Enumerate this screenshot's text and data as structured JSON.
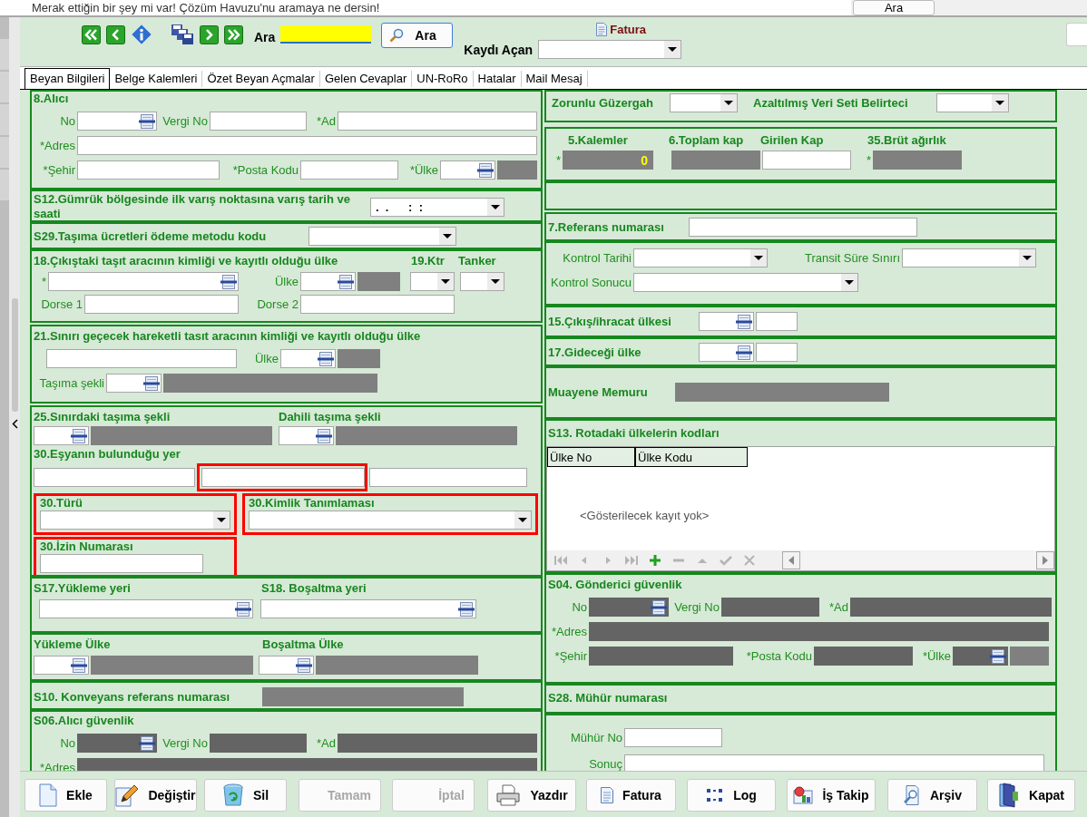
{
  "top_bar": {
    "message": "Merak ettiğin bir şey mi var! Çözüm Havuzu'nu aramaya ne dersin!",
    "button": "Ara"
  },
  "toolbar": {
    "search_label": "Ara",
    "search_button": "Ara",
    "invoice_link": "Fatura",
    "opener_label": "Kaydı Açan"
  },
  "tabs": [
    {
      "label": "Beyan Bilgileri",
      "selected": true
    },
    {
      "label": "Belge Kalemleri",
      "selected": false
    },
    {
      "label": "Özet Beyan Açmalar",
      "selected": false
    },
    {
      "label": "Gelen Cevaplar",
      "selected": false
    },
    {
      "label": "UN-RoRo",
      "selected": false
    },
    {
      "label": "Hatalar",
      "selected": false
    },
    {
      "label": "Mail Mesaj",
      "selected": false
    }
  ],
  "left_sections": [
    {
      "kind": "form",
      "rows": [
        [
          {
            "kind": "heading",
            "text": "8.Alıcı"
          }
        ],
        [
          {
            "kind": "label",
            "text": "No"
          },
          {
            "kind": "lookup",
            "disabled": false
          },
          {
            "kind": "label",
            "text": "Vergi No"
          },
          {
            "kind": "input",
            "disabled": false
          },
          {
            "kind": "label",
            "text": "*Ad"
          },
          {
            "kind": "input",
            "disabled": false
          }
        ],
        [
          {
            "kind": "label",
            "text": "*Adres"
          },
          {
            "kind": "input",
            "disabled": false
          }
        ],
        [
          {
            "kind": "label",
            "text": "*Şehir"
          },
          {
            "kind": "input",
            "disabled": false
          },
          {
            "kind": "label",
            "text": "*Posta Kodu"
          },
          {
            "kind": "input",
            "disabled": false
          },
          {
            "kind": "label",
            "text": "*Ülke"
          },
          {
            "kind": "lookup",
            "disabled": false
          },
          {
            "kind": "display"
          }
        ]
      ]
    },
    {
      "kind": "form",
      "rows": [
        [
          {
            "kind": "heading",
            "text": "S12.Gümrük bölgesinde ilk varış noktasına varış tarih ve saati"
          },
          {
            "kind": "combo",
            "value": ".  .      :  :"
          }
        ]
      ]
    },
    {
      "kind": "form",
      "rows": [
        [
          {
            "kind": "heading",
            "text": "S29.Taşıma ücretleri ödeme metodu kodu"
          },
          {
            "kind": "combo"
          }
        ]
      ]
    },
    {
      "kind": "form",
      "rows": [
        [
          {
            "kind": "heading",
            "text": "18.Çıkıştaki taşıt aracının kimliği ve kayıtlı olduğu ülke"
          },
          {
            "kind": "heading",
            "text": "19.Ktr"
          },
          {
            "kind": "heading",
            "text": "Tanker"
          }
        ],
        [
          {
            "kind": "label",
            "text": "*"
          },
          {
            "kind": "lookup",
            "disabled": false
          },
          {
            "kind": "label",
            "text": "Ülke"
          },
          {
            "kind": "lookup",
            "disabled": false
          },
          {
            "kind": "display"
          },
          {
            "kind": "combo"
          },
          {
            "kind": "combo"
          }
        ],
        [
          {
            "kind": "label",
            "text": "Dorse 1"
          },
          {
            "kind": "input",
            "disabled": false
          },
          {
            "kind": "label",
            "text": "Dorse 2"
          },
          {
            "kind": "input",
            "disabled": false
          }
        ]
      ]
    },
    {
      "kind": "form",
      "rows": [
        [
          {
            "kind": "heading",
            "text": "21.Sınırı geçecek hareketli tasıt aracının kimliği ve kayıtlı olduğu ülke"
          }
        ],
        [
          {
            "kind": "input",
            "disabled": false
          },
          {
            "kind": "label",
            "text": "Ülke"
          },
          {
            "kind": "lookup",
            "disabled": false
          },
          {
            "kind": "display"
          }
        ],
        [
          {
            "kind": "label",
            "text": "Taşıma şekli"
          },
          {
            "kind": "lookup",
            "disabled": false
          },
          {
            "kind": "display"
          }
        ]
      ]
    },
    {
      "kind": "form",
      "rows": [
        [
          {
            "kind": "heading",
            "text": "25.Sınırdaki taşıma şekli"
          },
          {
            "kind": "heading",
            "text": "Dahili taşıma şekli"
          }
        ],
        [
          {
            "kind": "lookup",
            "disabled": false
          },
          {
            "kind": "display"
          },
          {
            "kind": "lookup",
            "disabled": false
          },
          {
            "kind": "display"
          }
        ],
        [
          {
            "kind": "heading",
            "text": "30.Eşyanın bulunduğu yer"
          }
        ],
        [
          {
            "kind": "input",
            "disabled": false,
            "highlighted": false
          },
          {
            "kind": "input",
            "disabled": false,
            "highlighted": true
          },
          {
            "kind": "input",
            "disabled": false,
            "highlighted": false
          }
        ],
        [
          {
            "kind": "group",
            "highlighted": true,
            "children": [
              {
                "kind": "heading",
                "text": "30.Türü"
              },
              {
                "kind": "combo"
              }
            ]
          },
          {
            "kind": "group",
            "highlighted": true,
            "children": [
              {
                "kind": "heading",
                "text": "30.Kimlik Tanımlaması"
              },
              {
                "kind": "combo"
              }
            ]
          }
        ],
        [
          {
            "kind": "group",
            "highlighted": true,
            "children": [
              {
                "kind": "heading",
                "text": "30.İzin Numarası"
              },
              {
                "kind": "input",
                "disabled": false
              }
            ]
          }
        ]
      ]
    },
    {
      "kind": "form",
      "rows": [
        [
          {
            "kind": "heading",
            "text": "S17.Yükleme yeri"
          },
          {
            "kind": "heading",
            "text": "S18. Boşaltma yeri"
          }
        ],
        [
          {
            "kind": "lookup",
            "disabled": false
          },
          {
            "kind": "lookup",
            "disabled": false
          }
        ]
      ]
    },
    {
      "kind": "form",
      "rows": [
        [
          {
            "kind": "heading",
            "text": "Yükleme Ülke"
          },
          {
            "kind": "heading",
            "text": "Boşaltma Ülke"
          }
        ],
        [
          {
            "kind": "lookup",
            "disabled": false
          },
          {
            "kind": "display"
          },
          {
            "kind": "lookup",
            "disabled": false
          },
          {
            "kind": "display"
          }
        ]
      ]
    },
    {
      "kind": "form",
      "rows": [
        [
          {
            "kind": "heading",
            "text": "S10. Konveyans referans numarası"
          },
          {
            "kind": "display"
          }
        ]
      ]
    },
    {
      "kind": "form",
      "rows": [
        [
          {
            "kind": "heading",
            "text": "S06.Alıcı güvenlik"
          }
        ],
        [
          {
            "kind": "label",
            "text": "No"
          },
          {
            "kind": "lookup",
            "disabled": true
          },
          {
            "kind": "label",
            "text": "Vergi No"
          },
          {
            "kind": "input",
            "disabled": true
          },
          {
            "kind": "label",
            "text": "*Ad"
          },
          {
            "kind": "input",
            "disabled": true
          }
        ],
        [
          {
            "kind": "label",
            "text": "*Adres"
          },
          {
            "kind": "input",
            "disabled": true
          }
        ]
      ]
    }
  ],
  "right_sections": [
    {
      "kind": "form",
      "rows": [
        [
          {
            "kind": "heading",
            "text": "Zorunlu Güzergah"
          },
          {
            "kind": "combo"
          },
          {
            "kind": "heading",
            "text": "Azaltılmış Veri Seti Belirteci"
          },
          {
            "kind": "combo"
          }
        ]
      ]
    },
    {
      "kind": "form",
      "rows": [
        [
          {
            "kind": "heading",
            "text": "5.Kalemler"
          },
          {
            "kind": "heading",
            "text": "6.Toplam kap"
          },
          {
            "kind": "heading",
            "text": "Girilen Kap"
          },
          {
            "kind": "heading",
            "text": "35.Brüt ağırlık"
          }
        ],
        [
          {
            "kind": "label",
            "text": "*"
          },
          {
            "kind": "display",
            "value": "0"
          },
          {
            "kind": "display"
          },
          {
            "kind": "input",
            "disabled": false
          },
          {
            "kind": "label",
            "text": "*"
          },
          {
            "kind": "display"
          }
        ]
      ]
    },
    {
      "kind": "blank"
    },
    {
      "kind": "form",
      "rows": [
        [
          {
            "kind": "heading",
            "text": "7.Referans numarası"
          },
          {
            "kind": "input",
            "disabled": false
          }
        ]
      ]
    },
    {
      "kind": "form",
      "rows": [
        [
          {
            "kind": "label",
            "text": "Kontrol Tarihi"
          },
          {
            "kind": "combo"
          },
          {
            "kind": "label",
            "text": "Transit Süre Sınırı"
          },
          {
            "kind": "combo"
          }
        ],
        [
          {
            "kind": "label",
            "text": "Kontrol Sonucu"
          },
          {
            "kind": "combo"
          }
        ]
      ]
    },
    {
      "kind": "form",
      "rows": [
        [
          {
            "kind": "heading",
            "text": "15.Çıkış/ihracat ülkesi"
          },
          {
            "kind": "lookup",
            "disabled": false
          },
          {
            "kind": "input",
            "disabled": false
          }
        ]
      ]
    },
    {
      "kind": "form",
      "rows": [
        [
          {
            "kind": "heading",
            "text": "17.Gideceği ülke"
          },
          {
            "kind": "lookup",
            "disabled": false
          },
          {
            "kind": "input",
            "disabled": false
          }
        ]
      ]
    },
    {
      "kind": "form",
      "rows": [
        [
          {
            "kind": "heading",
            "text": "Muayene Memuru"
          },
          {
            "kind": "display"
          }
        ]
      ]
    },
    {
      "kind": "grid",
      "title": "S13. Rotadaki ülkelerin kodları",
      "columns": [
        "Ülke No",
        "Ülke Kodu"
      ],
      "empty_text": "<Gösterilecek kayıt yok>",
      "navigator": [
        {
          "kind": "first",
          "disabled": true
        },
        {
          "kind": "previous",
          "disabled": true
        },
        {
          "kind": "next",
          "disabled": true
        },
        {
          "kind": "last",
          "disabled": true
        },
        {
          "kind": "add",
          "disabled": false
        },
        {
          "kind": "remove",
          "disabled": true
        },
        {
          "kind": "up",
          "disabled": true
        },
        {
          "kind": "confirm",
          "disabled": true
        },
        {
          "kind": "cancel",
          "disabled": true
        }
      ]
    },
    {
      "kind": "form",
      "rows": [
        [
          {
            "kind": "heading",
            "text": "S04. Gönderici güvenlik"
          }
        ],
        [
          {
            "kind": "label",
            "text": "No"
          },
          {
            "kind": "lookup",
            "disabled": true
          },
          {
            "kind": "label",
            "text": "Vergi No"
          },
          {
            "kind": "input",
            "disabled": true
          },
          {
            "kind": "label",
            "text": "*Ad"
          },
          {
            "kind": "input",
            "disabled": true
          }
        ],
        [
          {
            "kind": "label",
            "text": "*Adres"
          },
          {
            "kind": "input",
            "disabled": true
          }
        ],
        [
          {
            "kind": "label",
            "text": "*Şehir"
          },
          {
            "kind": "input",
            "disabled": true
          },
          {
            "kind": "label",
            "text": "*Posta Kodu"
          },
          {
            "kind": "input",
            "disabled": true
          },
          {
            "kind": "label",
            "text": "*Ülke"
          },
          {
            "kind": "lookup",
            "disabled": true
          },
          {
            "kind": "display"
          }
        ]
      ]
    },
    {
      "kind": "form",
      "rows": [
        [
          {
            "kind": "heading",
            "text": "S28. Mühür numarası"
          }
        ]
      ]
    },
    {
      "kind": "form",
      "rows": [
        [
          {
            "kind": "label",
            "text": "Mühür No"
          },
          {
            "kind": "input",
            "disabled": false
          }
        ],
        [
          {
            "kind": "label",
            "text": "Sonuç"
          },
          {
            "kind": "input",
            "disabled": false
          }
        ]
      ]
    }
  ],
  "buttons": [
    {
      "label": "Ekle",
      "kind": "new",
      "disabled": false
    },
    {
      "label": "Değiştir",
      "kind": "edit",
      "disabled": false
    },
    {
      "label": "Sil",
      "kind": "delete",
      "disabled": false
    },
    {
      "label": "Tamam",
      "kind": "plain",
      "disabled": true
    },
    {
      "label": "İptal",
      "kind": "plain",
      "disabled": true
    },
    {
      "label": "Yazdır",
      "kind": "print",
      "disabled": false
    },
    {
      "label": "Fatura",
      "kind": "invoice",
      "disabled": false
    },
    {
      "label": "Log",
      "kind": "log",
      "disabled": false
    },
    {
      "label": "İş Takip",
      "kind": "tracking",
      "disabled": false
    },
    {
      "label": "Arşiv",
      "kind": "archive",
      "disabled": false
    },
    {
      "label": "Kapat",
      "kind": "close",
      "disabled": false
    }
  ]
}
